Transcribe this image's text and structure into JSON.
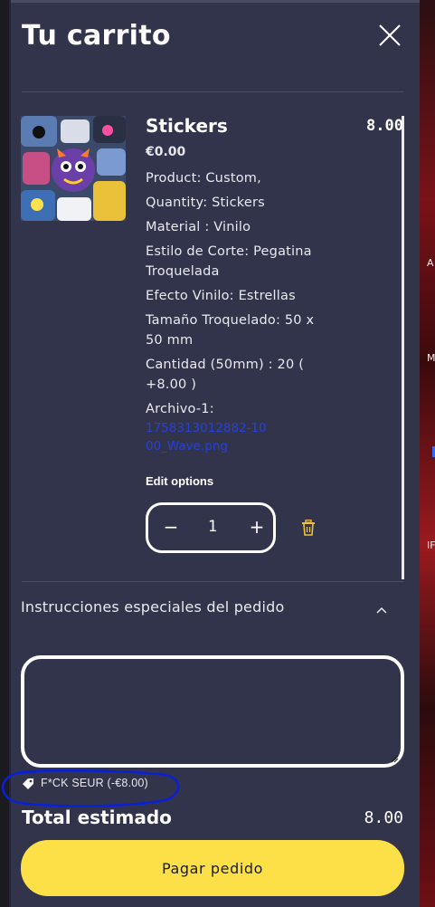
{
  "cart": {
    "title": "Tu carrito",
    "close_icon": "close-icon",
    "item": {
      "name": "Stickers",
      "line_total": "8.00",
      "price": "€0.00",
      "options": [
        "Product: Custom,",
        "Quantity: Stickers",
        "Material : Vinilo",
        "Estilo de Corte: Pegatina Troquelada",
        "Efecto Vinilo: Estrellas",
        "Tamaño Troquelado: 50 x 50 mm",
        "Cantidad (50mm) : 20 ( +8.00 )"
      ],
      "file_label": "Archivo-1:",
      "file_link": "1758313012882-1000_Wave.png",
      "edit_options": "Edit options",
      "quantity": "1",
      "minus_symbol": "−",
      "plus_symbol": "+",
      "delete_icon": "trash-icon"
    },
    "special_instructions": {
      "label": "Instrucciones especiales del pedido",
      "toggle_icon": "chevron-up-icon",
      "value": ""
    },
    "discount": {
      "icon": "tag-icon",
      "text": "F*CK SEUR (-€8.00)"
    },
    "total": {
      "label": "Total estimado",
      "value": "8.00"
    },
    "checkout_label": "Pagar pedido"
  },
  "backdrop": {
    "peek_letters": [
      "A",
      "M",
      "IF"
    ]
  },
  "colors": {
    "drawer_bg": "#32344b",
    "checkout_bg": "#fde047",
    "link": "#2740d6",
    "annotation": "#0a20d8",
    "trash": "#e9c23a"
  }
}
